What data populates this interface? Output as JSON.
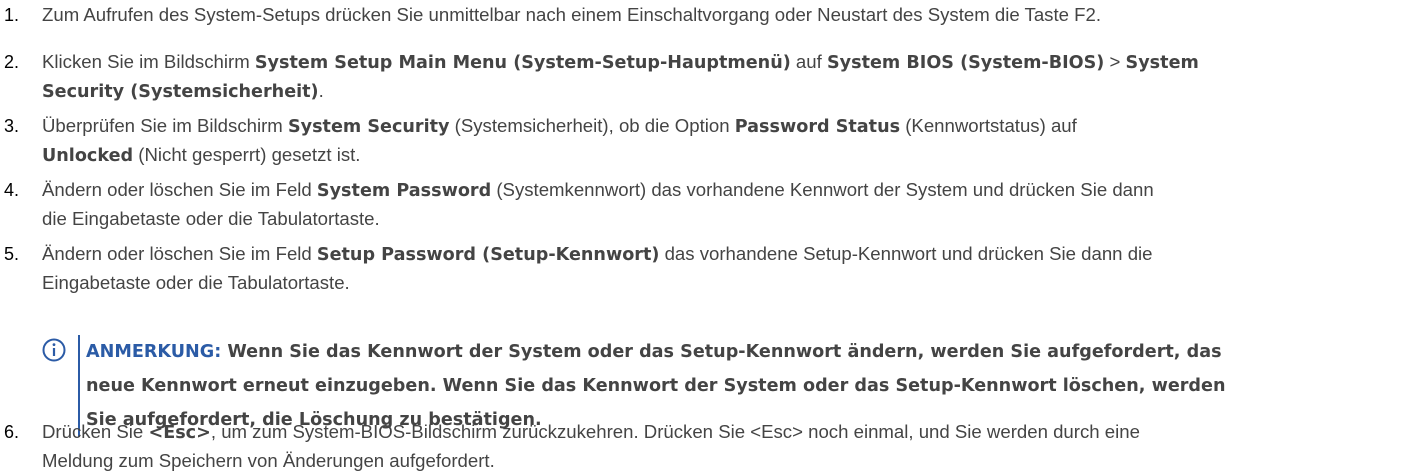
{
  "steps": [
    {
      "num": "1.",
      "lines": [
        [
          {
            "t": "Zum Aufrufen des System-Setups drücken Sie unmittelbar nach einem Einschaltvorgang oder Neustart des System die Taste F2."
          }
        ]
      ]
    },
    {
      "num": "2.",
      "lines": [
        [
          {
            "t": "Klicken Sie im Bildschirm "
          },
          {
            "t": "System Setup Main Menu (System-Setup-Hauptmenü)",
            "b": true
          },
          {
            "t": " auf "
          },
          {
            "t": "System BIOS (System-BIOS)",
            "b": true
          },
          {
            "t": " > "
          },
          {
            "t": "System",
            "b": true
          }
        ],
        [
          {
            "t": "Security (Systemsicherheit)",
            "b": true
          },
          {
            "t": "."
          }
        ]
      ]
    },
    {
      "num": "3.",
      "lines": [
        [
          {
            "t": "Überprüfen Sie im Bildschirm "
          },
          {
            "t": "System Security",
            "b": true
          },
          {
            "t": " (Systemsicherheit), ob die Option "
          },
          {
            "t": "Password Status",
            "b": true
          },
          {
            "t": " (Kennwortstatus) auf"
          }
        ],
        [
          {
            "t": "Unlocked",
            "b": true
          },
          {
            "t": " (Nicht gesperrt) gesetzt ist."
          }
        ]
      ]
    },
    {
      "num": "4.",
      "lines": [
        [
          {
            "t": "Ändern oder löschen Sie im Feld "
          },
          {
            "t": "System Password",
            "b": true
          },
          {
            "t": " (Systemkennwort) das vorhandene Kennwort der System und drücken Sie dann"
          }
        ],
        [
          {
            "t": "die Eingabetaste oder die Tabulatortaste."
          }
        ]
      ]
    },
    {
      "num": "5.",
      "lines": [
        [
          {
            "t": "Ändern oder löschen Sie im Feld "
          },
          {
            "t": "Setup Password (Setup-Kennwort)",
            "b": true
          },
          {
            "t": " das vorhandene Setup-Kennwort und drücken Sie dann die"
          }
        ],
        [
          {
            "t": "Eingabetaste oder die Tabulatortaste."
          }
        ]
      ]
    },
    {
      "num": "6.",
      "lines": [
        [
          {
            "t": "Drücken Sie "
          },
          {
            "t": "<Esc>",
            "b": true
          },
          {
            "t": ", um zum System-BIOS-Bildschirm zurückzukehren. Drücken Sie <Esc> noch einmal, und Sie werden durch eine"
          }
        ],
        [
          {
            "t": "Meldung zum Speichern von Änderungen aufgefordert."
          }
        ]
      ]
    }
  ],
  "note": {
    "icon": "info-circle-icon",
    "label": "ANMERKUNG:",
    "lines": [
      " Wenn Sie das Kennwort der System oder das Setup-Kennwort ändern, werden Sie aufgefordert, das",
      "neue Kennwort erneut einzugeben. Wenn Sie das Kennwort der System oder das Setup-Kennwort löschen, werden",
      "Sie aufgefordert, die Löschung zu bestätigen."
    ]
  },
  "colors": {
    "text": "#444444",
    "number": "#000000",
    "accent": "#2b5ba6"
  }
}
